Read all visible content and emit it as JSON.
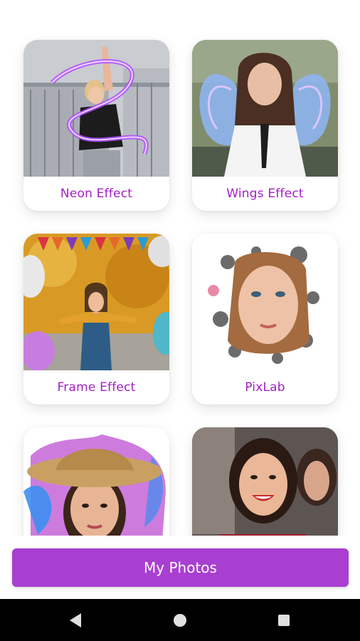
{
  "cards": [
    {
      "label": "Neon Effect"
    },
    {
      "label": "Wings Effect"
    },
    {
      "label": "Frame Effect"
    },
    {
      "label": "PixLab"
    },
    {
      "label": ""
    },
    {
      "label": ""
    }
  ],
  "bottom_button": {
    "label": "My Photos"
  },
  "colors": {
    "accent": "#a93fd0",
    "label_text": "#a21fc5"
  },
  "nav": {
    "back_icon": "back-triangle-icon",
    "home_icon": "home-circle-icon",
    "recent_icon": "recent-square-icon"
  }
}
